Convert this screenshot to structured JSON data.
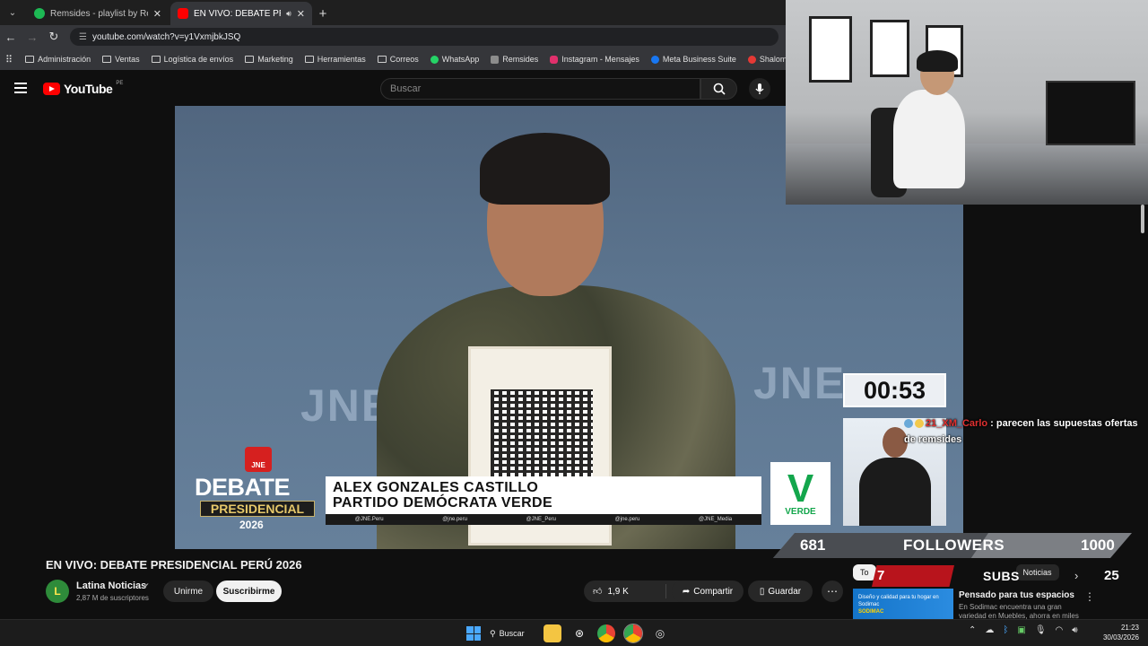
{
  "browser": {
    "tabs": [
      {
        "title": "Remsides - playlist by RemSide",
        "favicon_color": "#1db954",
        "active": false
      },
      {
        "title": "EN VIVO: DEBATE PRESIDEN",
        "favicon_color": "#ff0000",
        "active": true
      }
    ],
    "url": "youtube.com/watch?v=y1VxmjbkJSQ",
    "bookmarks": [
      {
        "label": "Administración",
        "icon": "folder-icon"
      },
      {
        "label": "Ventas",
        "icon": "folder-icon"
      },
      {
        "label": "Logística de envíos",
        "icon": "folder-icon"
      },
      {
        "label": "Marketing",
        "icon": "folder-icon"
      },
      {
        "label": "Herramientas",
        "icon": "folder-icon"
      },
      {
        "label": "Correos",
        "icon": "folder-icon"
      },
      {
        "label": "WhatsApp",
        "icon": "whatsapp-icon",
        "color": "#25d366"
      },
      {
        "label": "Remsides",
        "icon": "remsides-icon",
        "color": "#8c8c8c"
      },
      {
        "label": "Instagram - Mensajes",
        "icon": "instagram-icon",
        "color": "#e1306c"
      },
      {
        "label": "Meta Business Suite",
        "icon": "meta-icon",
        "color": "#1877f2"
      },
      {
        "label": "Shalom Agencias",
        "icon": "shalom-icon",
        "color": "#e53935"
      }
    ]
  },
  "youtube": {
    "logo_text": "YouTube",
    "country_code": "PE",
    "search_placeholder": "Buscar"
  },
  "video_overlay": {
    "timer": "00:53",
    "candidate_name": "ALEX GONZALES CASTILLO",
    "party_name": "PARTIDO DEMÓCRATA VERDE",
    "socials": [
      "@JNE.Peru",
      "@jne.peru",
      "@JNE_Peru",
      "@jne.peru",
      "@JNE_Media"
    ],
    "debate_word": "DEBATE",
    "presidencial_word": "PRESIDENCIAL",
    "year": "2026",
    "jne_badge": "JNE",
    "party_logo_letter": "V",
    "party_logo_word": "VERDE",
    "background_text": "JNE"
  },
  "video": {
    "title": "EN VIVO: DEBATE PRESIDENCIAL PERÚ 2026",
    "channel_name": "Latina Noticias",
    "channel_initial": "L",
    "subscribers": "2,87 M de suscriptores",
    "join_label": "Unirme",
    "subscribe_label": "Suscribirme",
    "likes": "1,9 K",
    "share_label": "Compartir",
    "save_label": "Guardar"
  },
  "stream_overlay": {
    "chat": {
      "user": "21_XM_Carlo",
      "message": "parecen las supuestas ofertas de remsides"
    },
    "followers": {
      "current": "681",
      "label": "FOLLOWERS",
      "goal": "1000"
    },
    "subs": {
      "current": "7",
      "label": "SUBS",
      "goal": "25"
    }
  },
  "chips": [
    "To",
    "Noticias"
  ],
  "ad": {
    "thumb_text": "Diseño y calidad para tu hogar en Sodimac",
    "brand": "SODIMAC",
    "title": "Pensado para tus espacios",
    "description": "En Sodimac encuentra una gran variedad en Muebles, ahorra en miles"
  },
  "taskbar": {
    "search_label": "Buscar",
    "time": "21:23",
    "date": "30/03/2026"
  }
}
